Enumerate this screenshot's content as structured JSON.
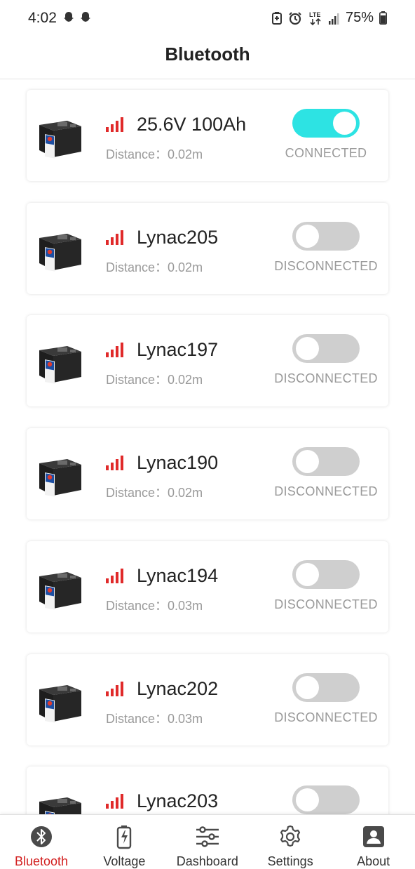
{
  "status_bar": {
    "time": "4:02",
    "network": "LTE",
    "battery_percent": "75%"
  },
  "header": {
    "title": "Bluetooth"
  },
  "colors": {
    "accent_red": "#d21f1f",
    "toggle_on": "#2de3e3",
    "toggle_off": "#cfcfcf"
  },
  "devices": [
    {
      "name": "25.6V 100Ah",
      "distance": "Distance：0.02m",
      "status": "CONNECTED",
      "connected": true
    },
    {
      "name": "Lynac205",
      "distance": "Distance：0.02m",
      "status": "DISCONNECTED",
      "connected": false
    },
    {
      "name": "Lynac197",
      "distance": "Distance：0.02m",
      "status": "DISCONNECTED",
      "connected": false
    },
    {
      "name": "Lynac190",
      "distance": "Distance：0.02m",
      "status": "DISCONNECTED",
      "connected": false
    },
    {
      "name": "Lynac194",
      "distance": "Distance：0.03m",
      "status": "DISCONNECTED",
      "connected": false
    },
    {
      "name": "Lynac202",
      "distance": "Distance：0.03m",
      "status": "DISCONNECTED",
      "connected": false
    },
    {
      "name": "Lynac203",
      "distance": "",
      "status": "",
      "connected": false
    }
  ],
  "bottom_nav": [
    {
      "label": "Bluetooth",
      "icon": "bluetooth-icon",
      "active": true
    },
    {
      "label": "Voltage",
      "icon": "battery-charging-icon",
      "active": false
    },
    {
      "label": "Dashboard",
      "icon": "sliders-icon",
      "active": false
    },
    {
      "label": "Settings",
      "icon": "gear-icon",
      "active": false
    },
    {
      "label": "About",
      "icon": "user-card-icon",
      "active": false
    }
  ]
}
